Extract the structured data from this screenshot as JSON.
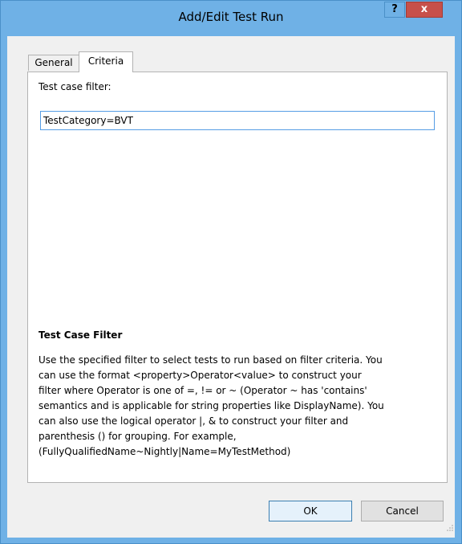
{
  "window": {
    "title": "Add/Edit Test Run",
    "help_label": "?",
    "close_label": "x"
  },
  "tabs": [
    {
      "label": "General",
      "active": false
    },
    {
      "label": "Criteria",
      "active": true
    }
  ],
  "criteria": {
    "filter_label": "Test case filter:",
    "filter_value": "TestCategory=BVT",
    "help_title": "Test Case Filter",
    "help_lines": [
      "Use the specified filter to select tests to run based on filter criteria. You",
      "can use the format <property>Operator<value> to construct your",
      "filter where Operator is one of =, != or ~  (Operator ~ has 'contains'",
      "semantics and is applicable for string properties like DisplayName). You",
      "can also use the logical operator |, & to construct your filter and",
      "parenthesis () for grouping. For example,",
      "(FullyQualifiedName~Nightly|Name=MyTestMethod)"
    ]
  },
  "buttons": {
    "ok_label": "OK",
    "cancel_label": "Cancel"
  },
  "colors": {
    "title_bar": "#6fb1e6",
    "close_button": "#c7504a",
    "input_focus_border": "#569de5",
    "ok_button_border": "#3c7fb1"
  },
  "icons": {
    "help": "question-mark-icon",
    "close": "close-icon",
    "resize": "resize-grip-icon"
  }
}
